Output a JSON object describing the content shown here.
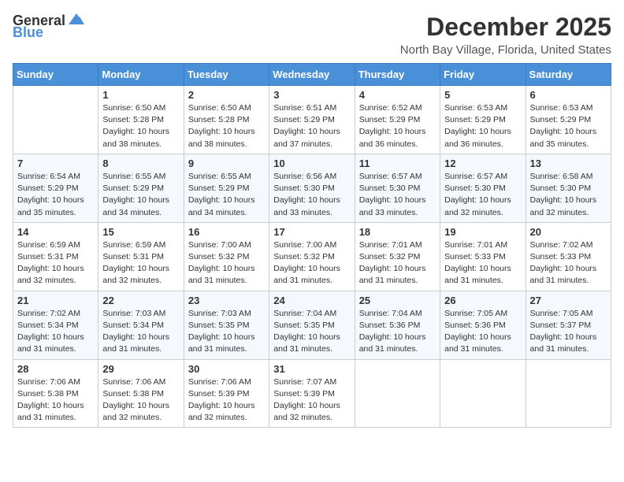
{
  "logo": {
    "general": "General",
    "blue": "Blue"
  },
  "title": {
    "month": "December 2025",
    "location": "North Bay Village, Florida, United States"
  },
  "weekdays": [
    "Sunday",
    "Monday",
    "Tuesday",
    "Wednesday",
    "Thursday",
    "Friday",
    "Saturday"
  ],
  "weeks": [
    [
      {
        "day": "",
        "sunrise": "",
        "sunset": "",
        "daylight": ""
      },
      {
        "day": "1",
        "sunrise": "Sunrise: 6:50 AM",
        "sunset": "Sunset: 5:28 PM",
        "daylight": "Daylight: 10 hours and 38 minutes."
      },
      {
        "day": "2",
        "sunrise": "Sunrise: 6:50 AM",
        "sunset": "Sunset: 5:28 PM",
        "daylight": "Daylight: 10 hours and 38 minutes."
      },
      {
        "day": "3",
        "sunrise": "Sunrise: 6:51 AM",
        "sunset": "Sunset: 5:29 PM",
        "daylight": "Daylight: 10 hours and 37 minutes."
      },
      {
        "day": "4",
        "sunrise": "Sunrise: 6:52 AM",
        "sunset": "Sunset: 5:29 PM",
        "daylight": "Daylight: 10 hours and 36 minutes."
      },
      {
        "day": "5",
        "sunrise": "Sunrise: 6:53 AM",
        "sunset": "Sunset: 5:29 PM",
        "daylight": "Daylight: 10 hours and 36 minutes."
      },
      {
        "day": "6",
        "sunrise": "Sunrise: 6:53 AM",
        "sunset": "Sunset: 5:29 PM",
        "daylight": "Daylight: 10 hours and 35 minutes."
      }
    ],
    [
      {
        "day": "7",
        "sunrise": "Sunrise: 6:54 AM",
        "sunset": "Sunset: 5:29 PM",
        "daylight": "Daylight: 10 hours and 35 minutes."
      },
      {
        "day": "8",
        "sunrise": "Sunrise: 6:55 AM",
        "sunset": "Sunset: 5:29 PM",
        "daylight": "Daylight: 10 hours and 34 minutes."
      },
      {
        "day": "9",
        "sunrise": "Sunrise: 6:55 AM",
        "sunset": "Sunset: 5:29 PM",
        "daylight": "Daylight: 10 hours and 34 minutes."
      },
      {
        "day": "10",
        "sunrise": "Sunrise: 6:56 AM",
        "sunset": "Sunset: 5:30 PM",
        "daylight": "Daylight: 10 hours and 33 minutes."
      },
      {
        "day": "11",
        "sunrise": "Sunrise: 6:57 AM",
        "sunset": "Sunset: 5:30 PM",
        "daylight": "Daylight: 10 hours and 33 minutes."
      },
      {
        "day": "12",
        "sunrise": "Sunrise: 6:57 AM",
        "sunset": "Sunset: 5:30 PM",
        "daylight": "Daylight: 10 hours and 32 minutes."
      },
      {
        "day": "13",
        "sunrise": "Sunrise: 6:58 AM",
        "sunset": "Sunset: 5:30 PM",
        "daylight": "Daylight: 10 hours and 32 minutes."
      }
    ],
    [
      {
        "day": "14",
        "sunrise": "Sunrise: 6:59 AM",
        "sunset": "Sunset: 5:31 PM",
        "daylight": "Daylight: 10 hours and 32 minutes."
      },
      {
        "day": "15",
        "sunrise": "Sunrise: 6:59 AM",
        "sunset": "Sunset: 5:31 PM",
        "daylight": "Daylight: 10 hours and 32 minutes."
      },
      {
        "day": "16",
        "sunrise": "Sunrise: 7:00 AM",
        "sunset": "Sunset: 5:32 PM",
        "daylight": "Daylight: 10 hours and 31 minutes."
      },
      {
        "day": "17",
        "sunrise": "Sunrise: 7:00 AM",
        "sunset": "Sunset: 5:32 PM",
        "daylight": "Daylight: 10 hours and 31 minutes."
      },
      {
        "day": "18",
        "sunrise": "Sunrise: 7:01 AM",
        "sunset": "Sunset: 5:32 PM",
        "daylight": "Daylight: 10 hours and 31 minutes."
      },
      {
        "day": "19",
        "sunrise": "Sunrise: 7:01 AM",
        "sunset": "Sunset: 5:33 PM",
        "daylight": "Daylight: 10 hours and 31 minutes."
      },
      {
        "day": "20",
        "sunrise": "Sunrise: 7:02 AM",
        "sunset": "Sunset: 5:33 PM",
        "daylight": "Daylight: 10 hours and 31 minutes."
      }
    ],
    [
      {
        "day": "21",
        "sunrise": "Sunrise: 7:02 AM",
        "sunset": "Sunset: 5:34 PM",
        "daylight": "Daylight: 10 hours and 31 minutes."
      },
      {
        "day": "22",
        "sunrise": "Sunrise: 7:03 AM",
        "sunset": "Sunset: 5:34 PM",
        "daylight": "Daylight: 10 hours and 31 minutes."
      },
      {
        "day": "23",
        "sunrise": "Sunrise: 7:03 AM",
        "sunset": "Sunset: 5:35 PM",
        "daylight": "Daylight: 10 hours and 31 minutes."
      },
      {
        "day": "24",
        "sunrise": "Sunrise: 7:04 AM",
        "sunset": "Sunset: 5:35 PM",
        "daylight": "Daylight: 10 hours and 31 minutes."
      },
      {
        "day": "25",
        "sunrise": "Sunrise: 7:04 AM",
        "sunset": "Sunset: 5:36 PM",
        "daylight": "Daylight: 10 hours and 31 minutes."
      },
      {
        "day": "26",
        "sunrise": "Sunrise: 7:05 AM",
        "sunset": "Sunset: 5:36 PM",
        "daylight": "Daylight: 10 hours and 31 minutes."
      },
      {
        "day": "27",
        "sunrise": "Sunrise: 7:05 AM",
        "sunset": "Sunset: 5:37 PM",
        "daylight": "Daylight: 10 hours and 31 minutes."
      }
    ],
    [
      {
        "day": "28",
        "sunrise": "Sunrise: 7:06 AM",
        "sunset": "Sunset: 5:38 PM",
        "daylight": "Daylight: 10 hours and 31 minutes."
      },
      {
        "day": "29",
        "sunrise": "Sunrise: 7:06 AM",
        "sunset": "Sunset: 5:38 PM",
        "daylight": "Daylight: 10 hours and 32 minutes."
      },
      {
        "day": "30",
        "sunrise": "Sunrise: 7:06 AM",
        "sunset": "Sunset: 5:39 PM",
        "daylight": "Daylight: 10 hours and 32 minutes."
      },
      {
        "day": "31",
        "sunrise": "Sunrise: 7:07 AM",
        "sunset": "Sunset: 5:39 PM",
        "daylight": "Daylight: 10 hours and 32 minutes."
      },
      {
        "day": "",
        "sunrise": "",
        "sunset": "",
        "daylight": ""
      },
      {
        "day": "",
        "sunrise": "",
        "sunset": "",
        "daylight": ""
      },
      {
        "day": "",
        "sunrise": "",
        "sunset": "",
        "daylight": ""
      }
    ]
  ]
}
